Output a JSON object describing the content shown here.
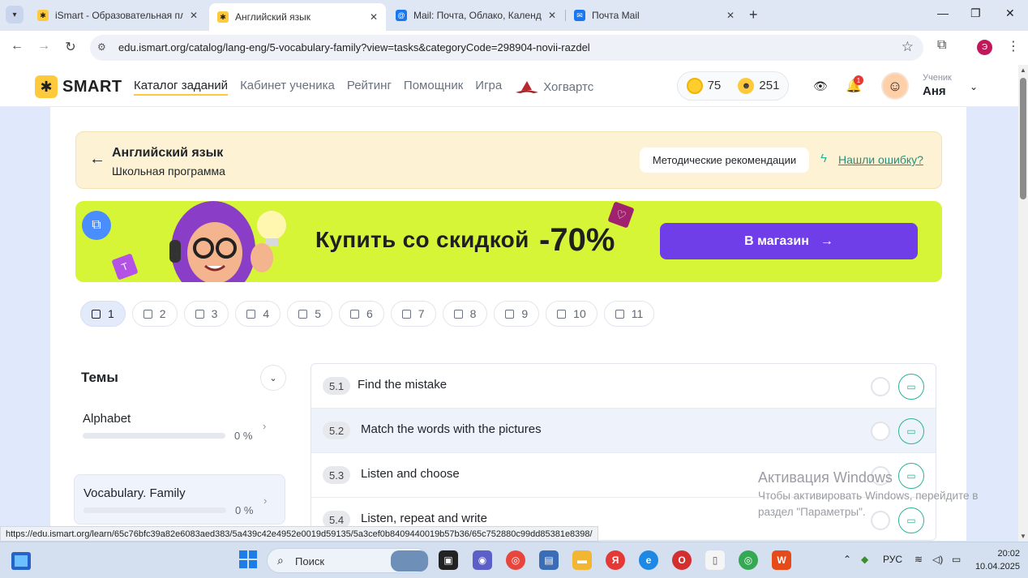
{
  "browser": {
    "tabs": [
      {
        "title": "iSmart - Образовательная пла",
        "active": false
      },
      {
        "title": "Английский язык",
        "active": true
      },
      {
        "title": "Mail: Почта, Облако, Календар",
        "active": false
      },
      {
        "title": "Почта Mail",
        "active": false
      }
    ],
    "url": "edu.ismart.org/catalog/lang-eng/5-vocabulary-family?view=tasks&categoryCode=298904-novii-razdel",
    "profile_initial": "Э",
    "status_url": "https://edu.ismart.org/learn/65c76bfc39a82e6083aed383/5a439c42e4952e0019d59135/5a3cef0b8409440019b57b36/65c752880c99dd85381e8398/"
  },
  "header": {
    "logo_text": "SMART",
    "nav": [
      "Каталог заданий",
      "Кабинет ученика",
      "Рейтинг",
      "Помощник",
      "Игра"
    ],
    "hogwarts": "Хогвартс",
    "coins": "75",
    "smiles": "251",
    "notifications": "1",
    "user_role": "Ученик",
    "user_name": "Аня"
  },
  "subject": {
    "title": "Английский язык",
    "subtitle": "Школьная программа",
    "methods_button": "Методические рекомендации",
    "report_link": "Нашли ошибку?"
  },
  "promo": {
    "text": "Купить со скидкой",
    "discount": "-70%",
    "button": "В магазин"
  },
  "grades": [
    "1",
    "2",
    "3",
    "4",
    "5",
    "6",
    "7",
    "8",
    "9",
    "10",
    "11"
  ],
  "topics": {
    "title": "Темы",
    "items": [
      {
        "name": "Alphabet",
        "percent": "0 %",
        "progress": 0
      },
      {
        "name": "Vocabulary. Family",
        "percent": "0 %",
        "progress": 0
      }
    ]
  },
  "tasks": [
    {
      "num": "5.1",
      "name": "Find the mistake"
    },
    {
      "num": "5.2",
      "name": "Match the words with the pictures"
    },
    {
      "num": "5.3",
      "name": "Listen and choose"
    },
    {
      "num": "5.4",
      "name": "Listen, repeat and write"
    }
  ],
  "activation": {
    "title": "Активация Windows",
    "subtitle": "Чтобы активировать Windows, перейдите в раздел \"Параметры\"."
  },
  "taskbar": {
    "search": "Поиск",
    "lang": "РУС",
    "time": "20:02",
    "date": "10.04.2025"
  }
}
